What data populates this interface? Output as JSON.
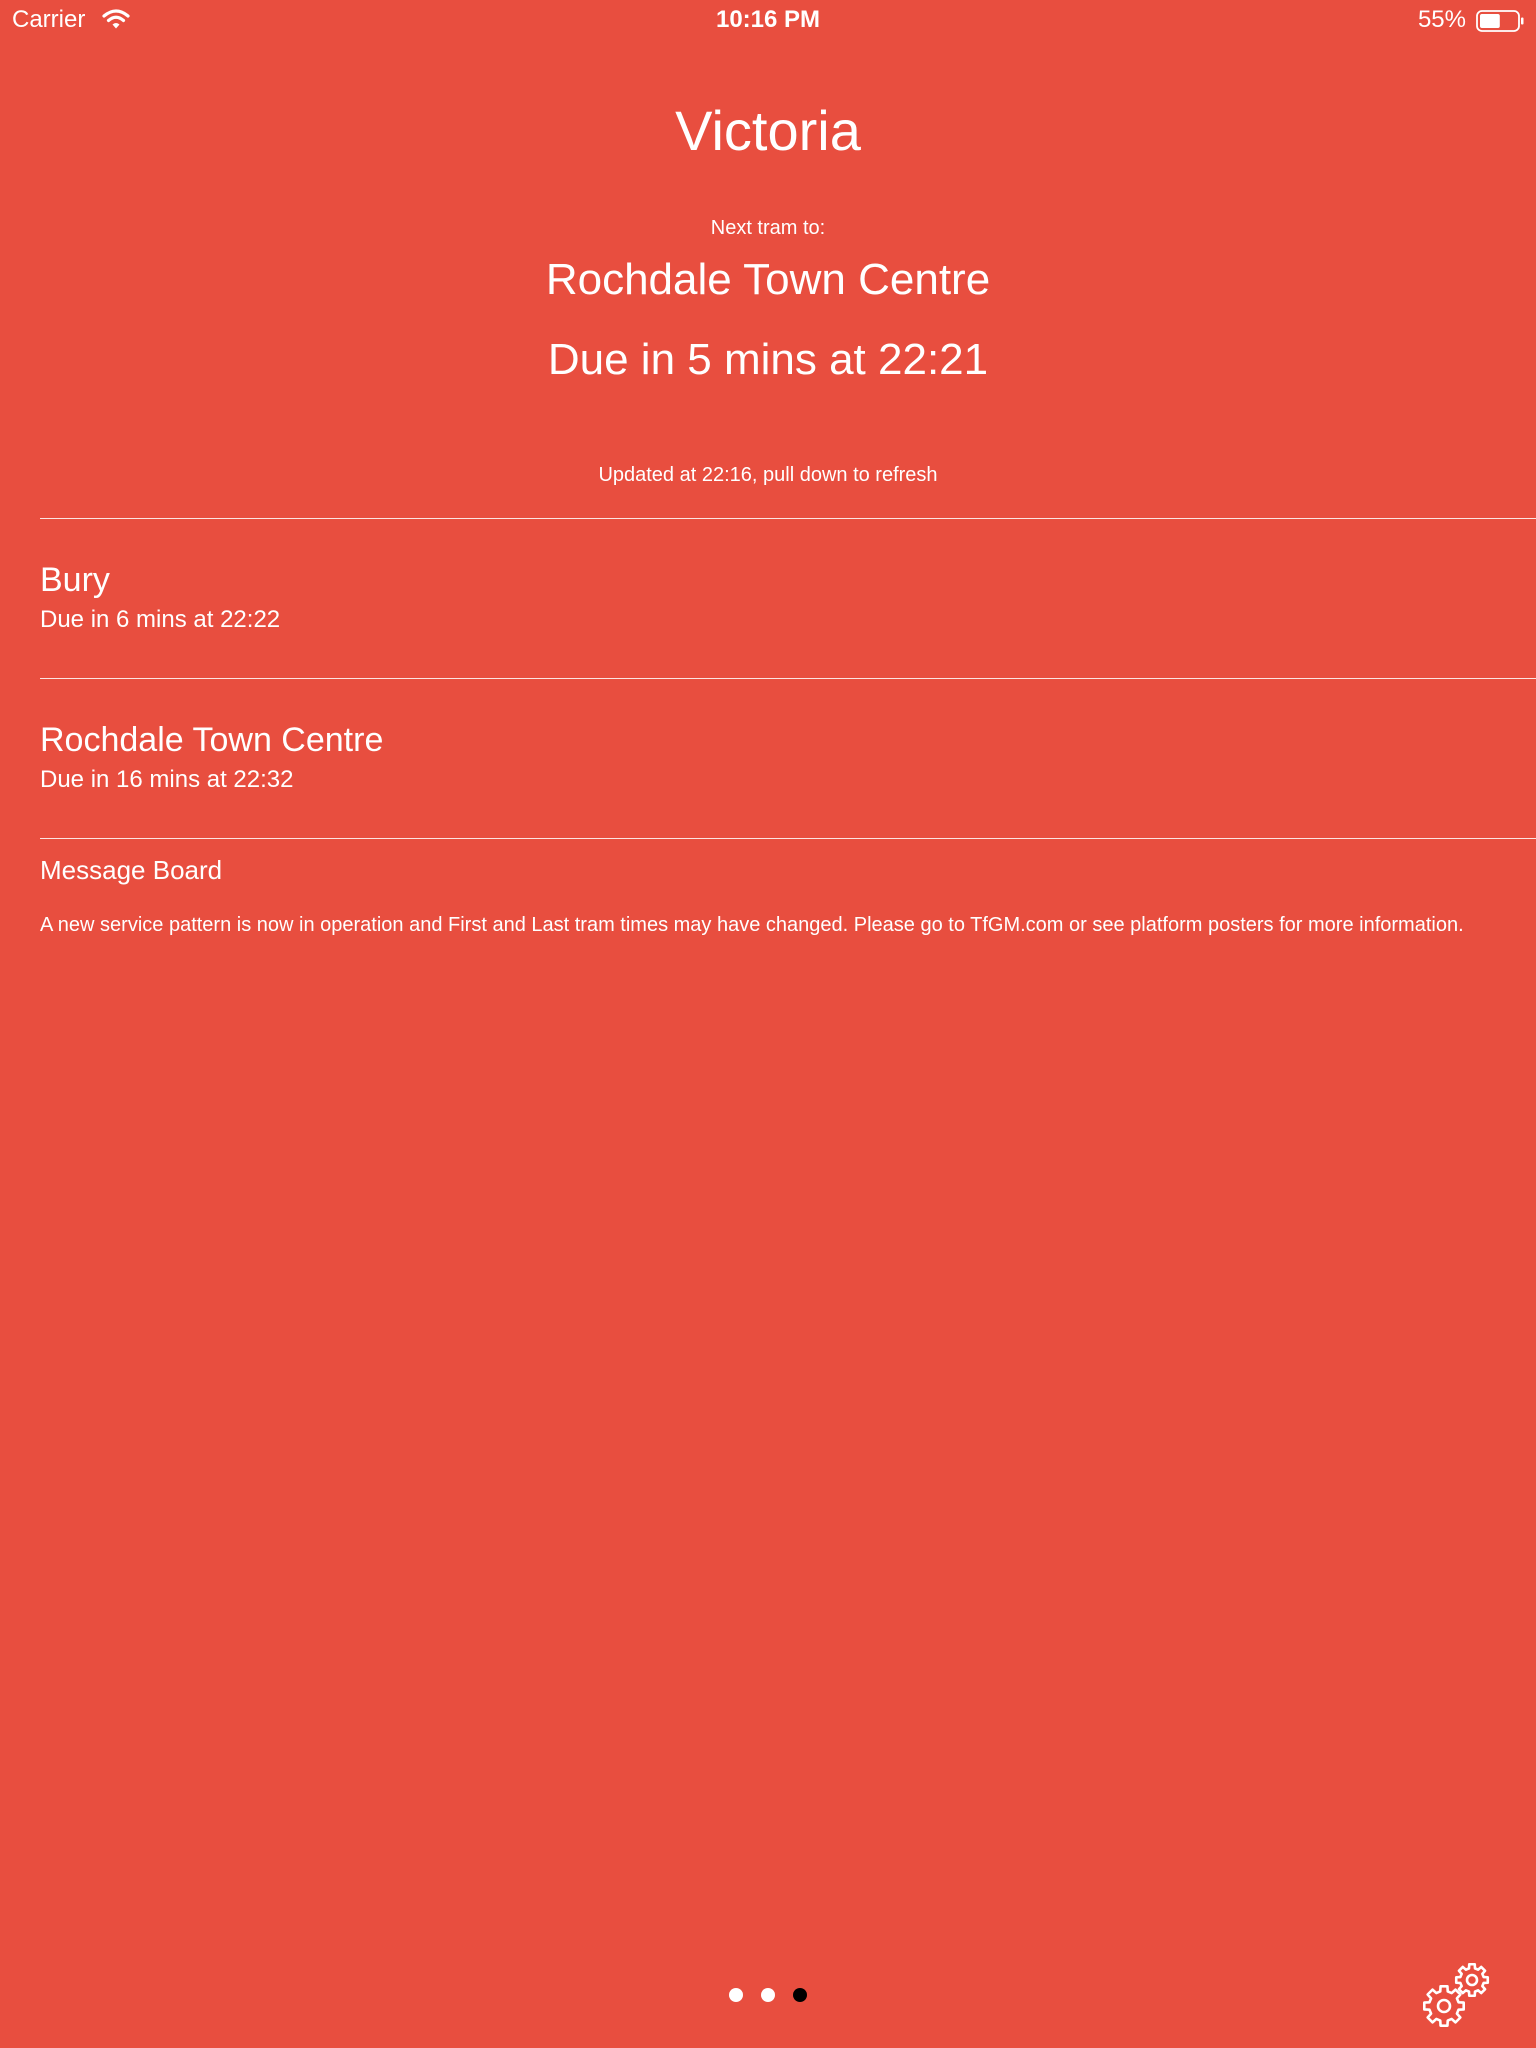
{
  "status_bar": {
    "carrier": "Carrier",
    "time": "10:16 PM",
    "battery_percent": "55%",
    "battery_level": 0.55,
    "wifi_icon": "wifi-icon",
    "battery_icon": "battery-icon"
  },
  "station": {
    "name": "Victoria"
  },
  "next_tram": {
    "label": "Next tram to:",
    "destination": "Rochdale Town Centre",
    "due": "Due in 5 mins at 22:21"
  },
  "updated_text": "Updated at 22:16, pull down to refresh",
  "departures": [
    {
      "destination": "Bury",
      "due": "Due in 6 mins at 22:22"
    },
    {
      "destination": "Rochdale Town Centre",
      "due": "Due in 16 mins at 22:32"
    }
  ],
  "message_board": {
    "heading": "Message Board",
    "body": "A new service pattern is now in operation and First and Last tram times may have changed. Please go to TfGM.com or see platform posters for more information."
  },
  "pager": {
    "count": 3,
    "current": 3
  },
  "settings_icon": "gears-icon",
  "colors": {
    "background": "#e84e3f",
    "text": "#ffffff",
    "active_dot": "#000000"
  }
}
